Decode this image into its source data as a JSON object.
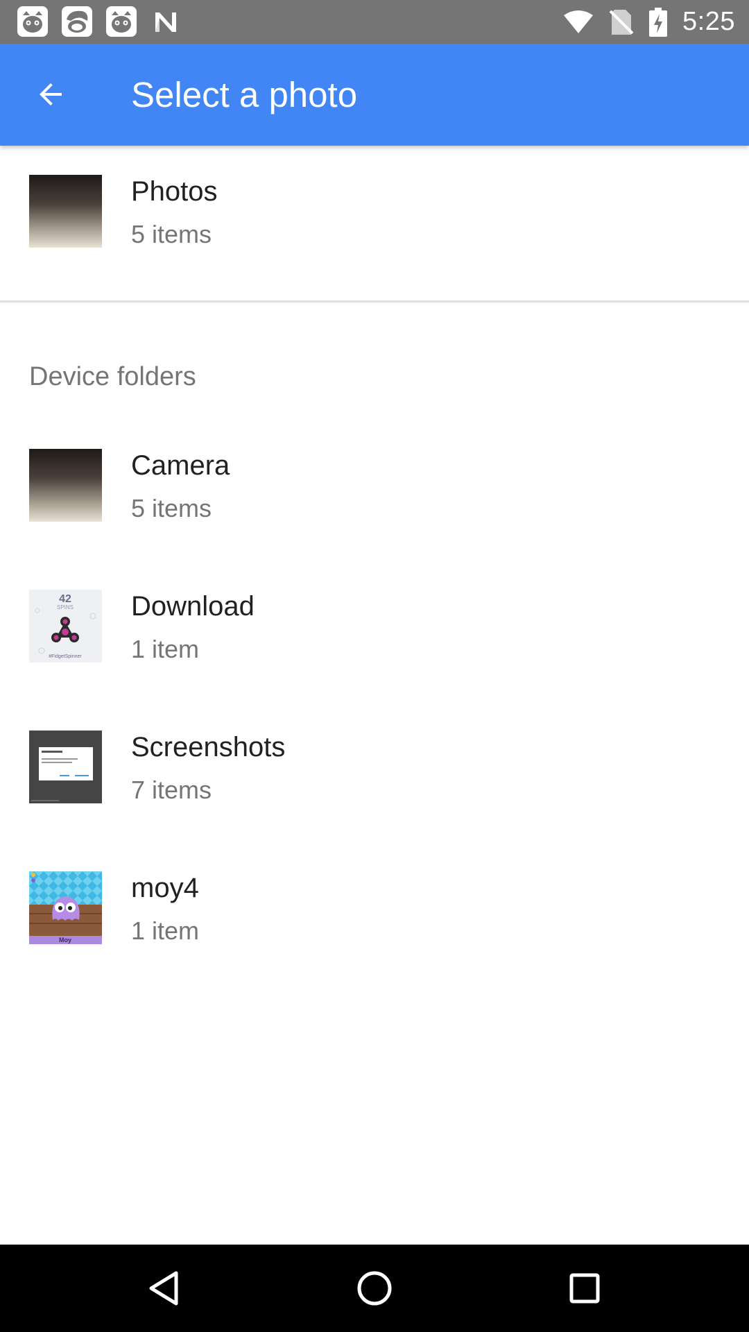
{
  "status_bar": {
    "time": "5:25",
    "notification_icons": [
      "cat-face-icon",
      "angela-face-icon",
      "cat-face-icon",
      "n-icon"
    ],
    "system_icons": [
      "wifi-icon",
      "no-sim-icon",
      "battery-charging-icon"
    ]
  },
  "app_bar": {
    "title": "Select a photo",
    "back_icon": "arrow-back-icon",
    "color": "#4285f4"
  },
  "top_item": {
    "title": "Photos",
    "subtitle": "5 items"
  },
  "section": {
    "header": "Device folders"
  },
  "folders": [
    {
      "title": "Camera",
      "subtitle": "5 items",
      "thumb": "dark-gradient-thumbnail"
    },
    {
      "title": "Download",
      "subtitle": "1 item",
      "thumb": "fidget-spinner-thumbnail",
      "thumb_text_top": "42",
      "thumb_text_mid": "SPINS",
      "thumb_text_bottom": "#FidgetSpinner"
    },
    {
      "title": "Screenshots",
      "subtitle": "7 items",
      "thumb": "dialog-screenshot-thumbnail"
    },
    {
      "title": "moy4",
      "subtitle": "1 item",
      "thumb": "moy-game-thumbnail",
      "thumb_text": "Moy"
    }
  ],
  "nav_bar": {
    "icons": [
      "back-triangle-icon",
      "home-circle-icon",
      "recents-square-icon"
    ]
  }
}
